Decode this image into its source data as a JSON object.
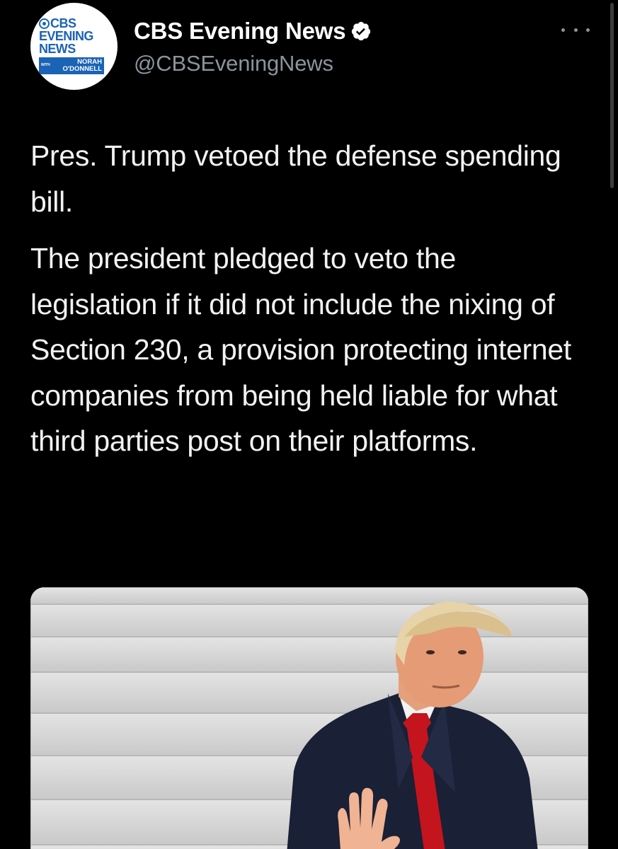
{
  "tweet": {
    "author": {
      "display_name": "CBS Evening News",
      "handle": "@CBSEveningNews",
      "verified": true,
      "avatar": {
        "logo_line1": "CBS",
        "logo_line2": "EVENING",
        "logo_line3": "NEWS",
        "logo_with": "WITH",
        "logo_name1": "NORAH",
        "logo_name2": "O'DONNELL"
      }
    },
    "text_paragraphs": [
      "Pres. Trump vetoed the defense spending bill.",
      "The president pledged to veto the legislation if it did not include the nixing of Section 230, a provision protecting internet companies from being held liable for what third parties post on their platforms."
    ],
    "media": {
      "kind": "photo"
    }
  },
  "colors": {
    "background": "#000000",
    "text_primary": "#ffffff",
    "text_secondary": "#8b949b",
    "verified_badge": "#ffffff",
    "cbs_blue": "#1b63b5"
  },
  "icons": {
    "verified": "verified-badge-icon",
    "more": "more-options-icon"
  }
}
